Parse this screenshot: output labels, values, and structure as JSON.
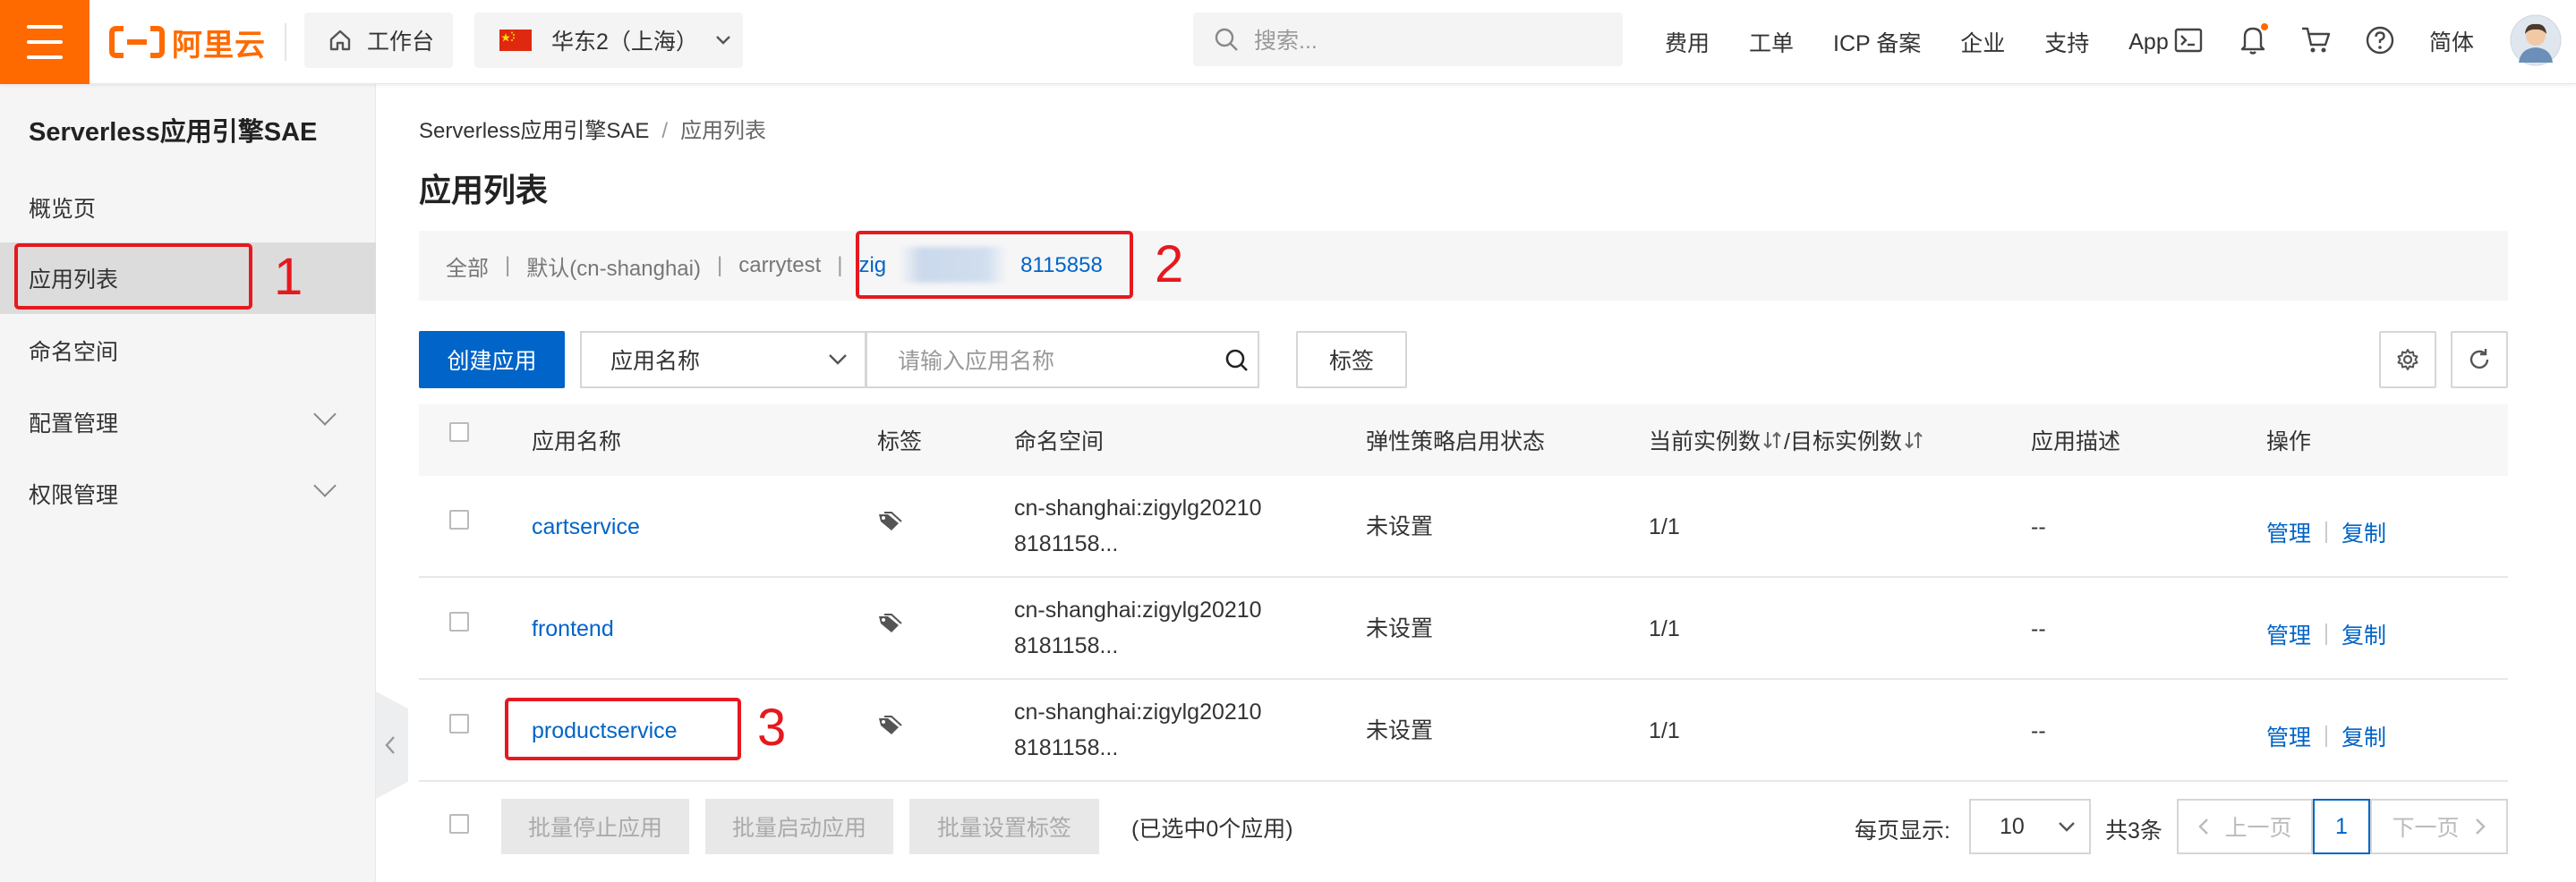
{
  "topbar": {
    "brand": "阿里云",
    "workbench": "工作台",
    "region": "华东2（上海）",
    "search_placeholder": "搜索...",
    "links": [
      "费用",
      "工单",
      "ICP 备案",
      "企业",
      "支持",
      "App"
    ],
    "language": "简体",
    "accent_color": "#ff6a00",
    "icons": [
      "terminal-icon",
      "bell-icon",
      "cart-icon",
      "help-icon"
    ]
  },
  "sidebar": {
    "title": "Serverless应用引擎SAE",
    "items": [
      {
        "label": "概览页"
      },
      {
        "label": "应用列表"
      },
      {
        "label": "命名空间"
      },
      {
        "label": "配置管理"
      },
      {
        "label": "权限管理"
      }
    ]
  },
  "main": {
    "breadcrumb": [
      "Serverless应用引擎SAE",
      "应用列表"
    ],
    "title": "应用列表",
    "filter": {
      "items": [
        "全部",
        "默认(cn-shanghai)",
        "carrytest"
      ],
      "selected_prefix": "zig",
      "selected_suffix": "8115858"
    },
    "toolbar": {
      "create_label": "创建应用",
      "search_field": "应用名称",
      "search_placeholder": "请输入应用名称",
      "tag_label": "标签"
    },
    "table": {
      "headers": [
        "应用名称",
        "标签",
        "命名空间",
        "弹性策略启用状态",
        "当前实例数",
        "/目标实例数",
        "应用描述",
        "操作"
      ],
      "rows": [
        {
          "name": "cartservice",
          "ns1": "cn-shanghai:zigylg20210",
          "ns2": "8181158...",
          "elastic": "未设置",
          "instances": "1/1",
          "desc": "--",
          "op1": "管理",
          "op2": "复制"
        },
        {
          "name": "frontend",
          "ns1": "cn-shanghai:zigylg20210",
          "ns2": "8181158...",
          "elastic": "未设置",
          "instances": "1/1",
          "desc": "--",
          "op1": "管理",
          "op2": "复制"
        },
        {
          "name": "productservice",
          "ns1": "cn-shanghai:zigylg20210",
          "ns2": "8181158...",
          "elastic": "未设置",
          "instances": "1/1",
          "desc": "--",
          "op1": "管理",
          "op2": "复制"
        }
      ]
    },
    "footer": {
      "batch_stop": "批量停止应用",
      "batch_start": "批量启动应用",
      "batch_tag": "批量设置标签",
      "selected": "(已选中0个应用)",
      "page_size_label": "每页显示:",
      "page_size": "10",
      "total": "共3条",
      "prev": "上一页",
      "page": "1",
      "next": "下一页"
    }
  },
  "annotations": {
    "n1": "1",
    "n2": "2",
    "n3": "3",
    "color": "#e5191e"
  }
}
